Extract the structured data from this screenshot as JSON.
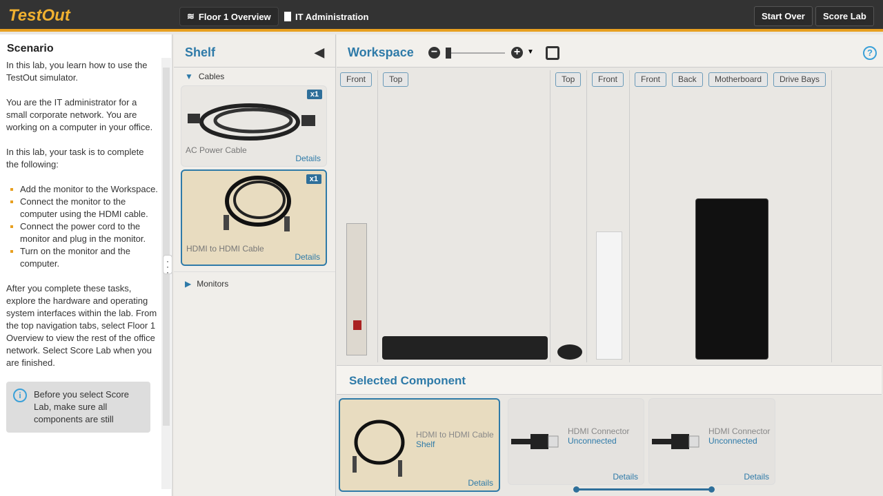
{
  "header": {
    "logo": "TestOut",
    "breadcrumbs": [
      "Floor 1 Overview",
      "IT Administration"
    ],
    "start_over": "Start Over",
    "score_lab": "Score Lab"
  },
  "scenario": {
    "title": "Scenario",
    "p1": "In this lab, you learn how to use the TestOut simulator.",
    "p2": "You are the IT administrator for a small corporate network. You are working on a computer in your office.",
    "p3": "In this lab, your task is to complete the following:",
    "tasks": [
      "Add the monitor to the Workspace.",
      "Connect the monitor to the computer using the HDMI cable.",
      "Connect the power cord to the monitor and plug in the monitor.",
      "Turn on the monitor and the computer."
    ],
    "p4": "After you complete these tasks, explore the hardware and operating system interfaces within the lab. From the top navigation tabs, select Floor 1 Overview to view the rest of the office network. Select Score Lab when you are finished.",
    "note": "Before you select Score Lab, make sure all components are still"
  },
  "shelf": {
    "title": "Shelf",
    "categories": [
      {
        "label": "Cables",
        "expanded": true
      },
      {
        "label": "Monitors",
        "expanded": false
      }
    ],
    "items": [
      {
        "label": "AC Power Cable",
        "count": "x1",
        "details": "Details"
      },
      {
        "label": "HDMI to HDMI Cable",
        "count": "x1",
        "details": "Details",
        "selected": true
      }
    ]
  },
  "workspace": {
    "title": "Workspace",
    "zoom_level": 0.05,
    "views": [
      "Front",
      "Top",
      "Top",
      "Front",
      "Front",
      "Back",
      "Motherboard",
      "Drive Bays"
    ]
  },
  "selected_component": {
    "title": "Selected Component",
    "cards": [
      {
        "name": "HDMI to HDMI Cable",
        "status": "Shelf",
        "details": "Details"
      },
      {
        "name": "HDMI Connector",
        "status": "Unconnected",
        "details": "Details"
      },
      {
        "name": "HDMI Connector",
        "status": "Unconnected",
        "details": "Details"
      }
    ]
  },
  "colors": {
    "accent": "#2e7aa8",
    "brand": "#f0b030",
    "topbar": "#333333"
  }
}
